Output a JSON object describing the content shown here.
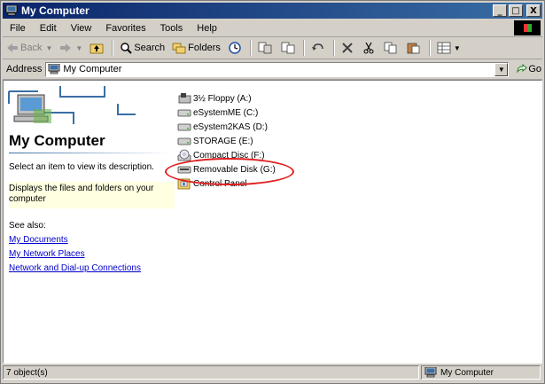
{
  "window": {
    "title": "My Computer"
  },
  "title_buttons": {
    "minimize": "_",
    "maximize": "□",
    "close": "X"
  },
  "menu": [
    "File",
    "Edit",
    "View",
    "Favorites",
    "Tools",
    "Help"
  ],
  "toolbar": {
    "back": "Back",
    "search": "Search",
    "folders": "Folders"
  },
  "address": {
    "label": "Address",
    "value": "My Computer",
    "go": "Go"
  },
  "left_pane": {
    "title": "My Computer",
    "select_message": "Select an item to view its description.",
    "description": "Displays the files and folders on your computer",
    "see_also_label": "See also:",
    "links": [
      "My Documents",
      "My Network Places",
      "Network and Dial-up Connections"
    ]
  },
  "drives": [
    {
      "label": "3½ Floppy (A:)",
      "icon": "floppy-icon"
    },
    {
      "label": "eSystemME (C:)",
      "icon": "hard-drive-icon"
    },
    {
      "label": "eSystem2KAS (D:)",
      "icon": "hard-drive-icon"
    },
    {
      "label": "STORAGE (E:)",
      "icon": "hard-drive-icon"
    },
    {
      "label": "Compact Disc (F:)",
      "icon": "cd-icon"
    },
    {
      "label": "Removable Disk (G:)",
      "icon": "removable-disk-icon"
    },
    {
      "label": "Control Panel",
      "icon": "control-panel-icon"
    }
  ],
  "status": {
    "count": "7 object(s)",
    "location": "My Computer"
  },
  "colors": {
    "titlebar": "#0a246a",
    "highlight": "#e02020",
    "link": "#0000cc"
  }
}
